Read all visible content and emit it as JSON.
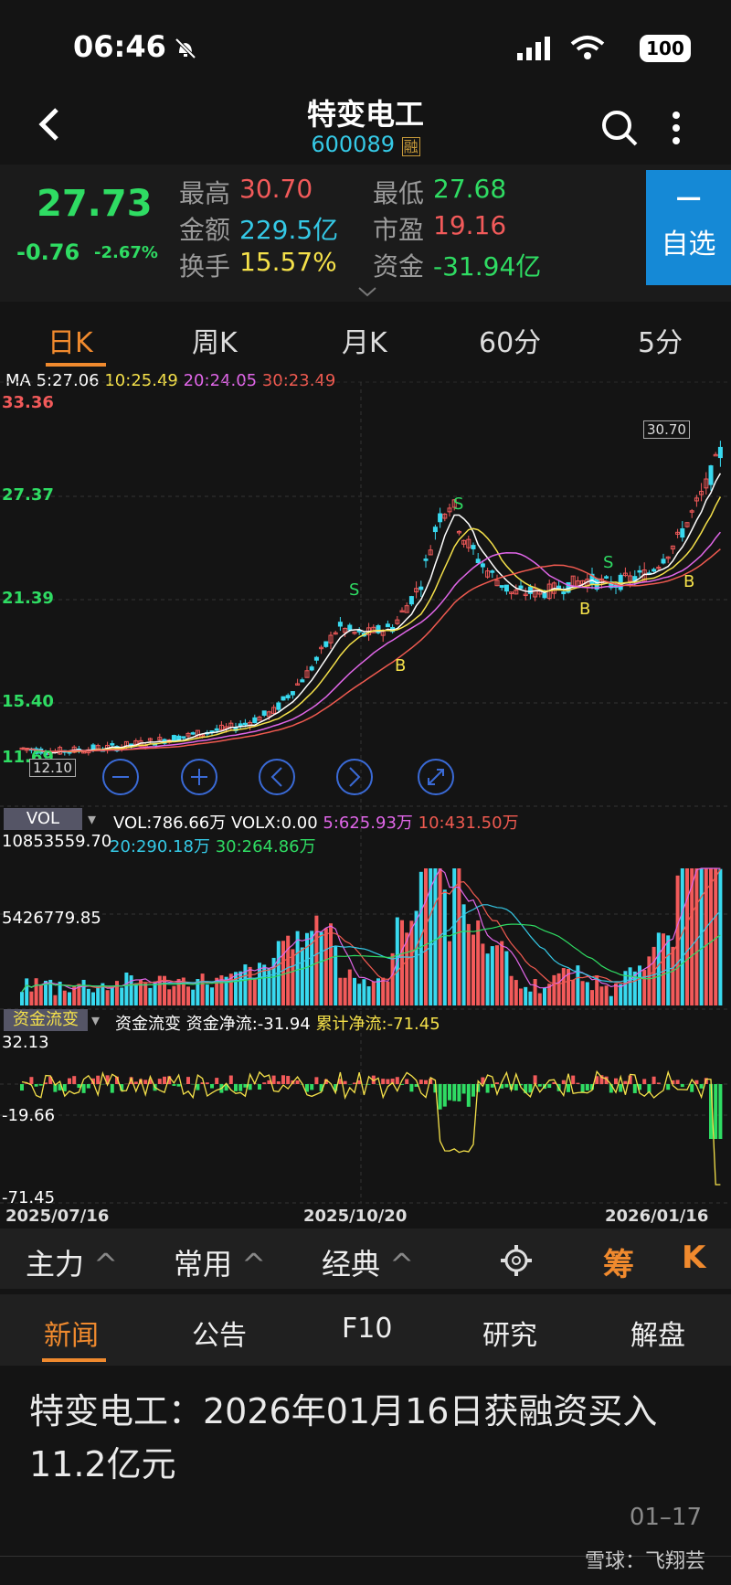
{
  "status": {
    "time": "06:46",
    "battery": "100"
  },
  "header": {
    "title": "特变电工",
    "code": "600089",
    "margin_badge": "融"
  },
  "quote": {
    "price": "27.73",
    "change": "-0.76",
    "change_pct": "-2.67%",
    "high_label": "最高",
    "high": "30.70",
    "low_label": "最低",
    "low": "27.68",
    "amount_label": "金额",
    "amount": "229.5亿",
    "pe_label": "市盈",
    "pe": "19.16",
    "turnover_label": "换手",
    "turnover": "15.57%",
    "fund_label": "资金",
    "fund": "-31.94亿",
    "watch_minus": "−",
    "watch_label": "自选"
  },
  "ktabs": [
    "日K",
    "周K",
    "月K",
    "60分",
    "5分"
  ],
  "ma": {
    "label": "MA",
    "ma5": "5:27.06",
    "ma10": "10:25.49",
    "ma20": "20:24.05",
    "ma30": "30:23.49"
  },
  "axis": {
    "p1": "33.36",
    "p2": "27.37",
    "p3": "21.39",
    "p4": "15.40",
    "p5": "11.69",
    "low_mark": "12.10",
    "high_mark": "30.70"
  },
  "markers": {
    "s": "S",
    "b": "B"
  },
  "vol": {
    "tag": "VOL",
    "vol": "VOL:786.66万",
    "volx": "VOLX:0.00",
    "v5": "5:625.93万",
    "v10": "10:431.50万",
    "v20": "20:290.18万",
    "v30": "30:264.86万",
    "y1": "10853559.70",
    "y2": "5426779.85"
  },
  "flow": {
    "tag": "资金流变",
    "name": "资金流变",
    "net": "资金净流:-31.94",
    "cum": "累计净流:-71.45",
    "y1": "32.13",
    "y2": "-19.66",
    "y3": "-71.45"
  },
  "dates": [
    "2025/07/16",
    "2025/10/20",
    "2026/01/16"
  ],
  "toolbar": {
    "t1": "主力",
    "t2": "常用",
    "t3": "经典",
    "chip": "筹",
    "k": "K"
  },
  "news_tabs": [
    "新闻",
    "公告",
    "F10",
    "研究",
    "解盘"
  ],
  "news": {
    "title": "特变电工：2026年01月16日获融资买入11.2亿元",
    "date": "01–17"
  },
  "watermark": "雪球：飞翔芸",
  "colors": {
    "up": "#f25a5a",
    "down": "#38d9ef",
    "green": "#2fdc63",
    "ma5": "#ffffff",
    "ma10": "#f5e14a",
    "ma20": "#e066e8",
    "ma30": "#f05a50",
    "accent": "#f08a2e"
  },
  "chart_data": {
    "type": "line",
    "title": "特变电工 日K",
    "x": [
      "2025/07/16",
      "2025/10/20",
      "2026/01/16"
    ],
    "series": [
      {
        "name": "MA5",
        "values": [
          12.4,
          22.5,
          27.06
        ]
      },
      {
        "name": "MA10",
        "values": [
          12.2,
          21.9,
          25.49
        ]
      },
      {
        "name": "MA20",
        "values": [
          12.0,
          20.8,
          24.05
        ]
      },
      {
        "name": "MA30",
        "values": [
          11.9,
          19.9,
          23.49
        ]
      }
    ],
    "ylim": [
      11.69,
      33.36
    ]
  }
}
